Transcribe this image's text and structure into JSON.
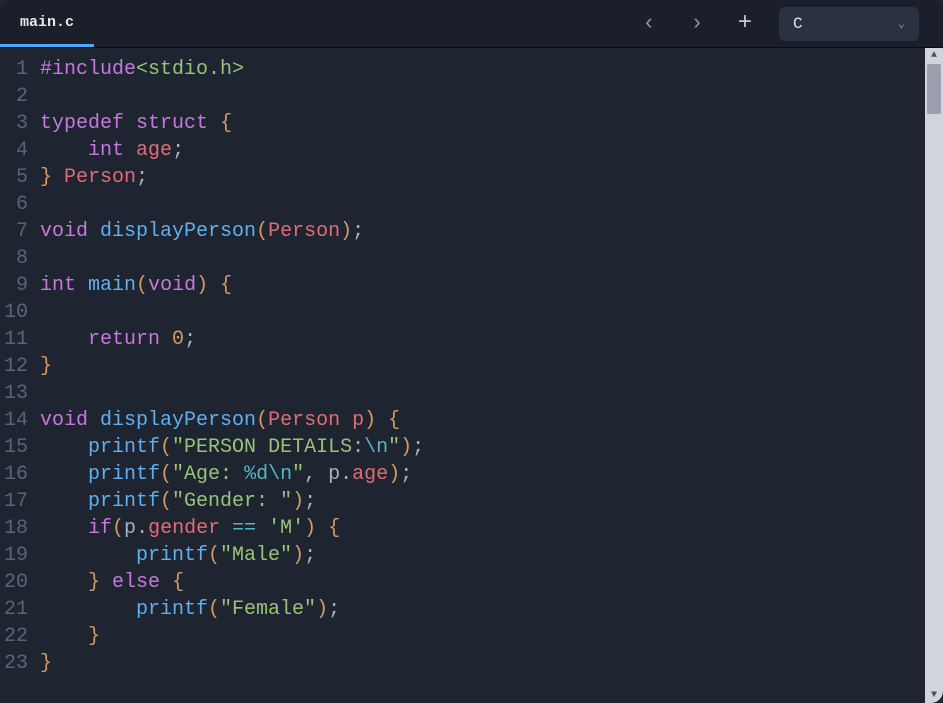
{
  "tab": {
    "filename": "main.c"
  },
  "header": {
    "nav_back": "‹",
    "nav_forward": "›",
    "add": "+",
    "language": "C",
    "chevron": "⌄"
  },
  "code": {
    "lines": [
      {
        "n": "1",
        "tokens": [
          {
            "c": "t-preprocessor",
            "t": "#include"
          },
          {
            "c": "t-include-lit",
            "t": "<stdio.h>"
          }
        ]
      },
      {
        "n": "2",
        "tokens": []
      },
      {
        "n": "3",
        "tokens": [
          {
            "c": "t-keyword",
            "t": "typedef"
          },
          {
            "c": "t-default",
            "t": " "
          },
          {
            "c": "t-keyword",
            "t": "struct"
          },
          {
            "c": "t-default",
            "t": " "
          },
          {
            "c": "t-brace",
            "t": "{"
          }
        ]
      },
      {
        "n": "4",
        "tokens": [
          {
            "c": "t-default",
            "t": "    "
          },
          {
            "c": "t-type",
            "t": "int"
          },
          {
            "c": "t-default",
            "t": " "
          },
          {
            "c": "t-identifier",
            "t": "age"
          },
          {
            "c": "t-punct",
            "t": ";"
          }
        ]
      },
      {
        "n": "5",
        "tokens": [
          {
            "c": "t-brace",
            "t": "}"
          },
          {
            "c": "t-default",
            "t": " "
          },
          {
            "c": "t-identifier",
            "t": "Person"
          },
          {
            "c": "t-punct",
            "t": ";"
          }
        ]
      },
      {
        "n": "6",
        "tokens": []
      },
      {
        "n": "7",
        "tokens": [
          {
            "c": "t-type",
            "t": "void"
          },
          {
            "c": "t-default",
            "t": " "
          },
          {
            "c": "t-function",
            "t": "displayPerson"
          },
          {
            "c": "t-brace",
            "t": "("
          },
          {
            "c": "t-identifier",
            "t": "Person"
          },
          {
            "c": "t-brace",
            "t": ")"
          },
          {
            "c": "t-punct",
            "t": ";"
          }
        ]
      },
      {
        "n": "8",
        "tokens": []
      },
      {
        "n": "9",
        "tokens": [
          {
            "c": "t-type",
            "t": "int"
          },
          {
            "c": "t-default",
            "t": " "
          },
          {
            "c": "t-function",
            "t": "main"
          },
          {
            "c": "t-brace",
            "t": "("
          },
          {
            "c": "t-type",
            "t": "void"
          },
          {
            "c": "t-brace",
            "t": ")"
          },
          {
            "c": "t-default",
            "t": " "
          },
          {
            "c": "t-brace",
            "t": "{"
          }
        ]
      },
      {
        "n": "10",
        "tokens": []
      },
      {
        "n": "11",
        "tokens": [
          {
            "c": "t-default",
            "t": "    "
          },
          {
            "c": "t-keyword",
            "t": "return"
          },
          {
            "c": "t-default",
            "t": " "
          },
          {
            "c": "t-number",
            "t": "0"
          },
          {
            "c": "t-punct",
            "t": ";"
          }
        ]
      },
      {
        "n": "12",
        "tokens": [
          {
            "c": "t-brace",
            "t": "}"
          }
        ]
      },
      {
        "n": "13",
        "tokens": []
      },
      {
        "n": "14",
        "tokens": [
          {
            "c": "t-type",
            "t": "void"
          },
          {
            "c": "t-default",
            "t": " "
          },
          {
            "c": "t-function",
            "t": "displayPerson"
          },
          {
            "c": "t-brace",
            "t": "("
          },
          {
            "c": "t-identifier",
            "t": "Person"
          },
          {
            "c": "t-default",
            "t": " "
          },
          {
            "c": "t-param",
            "t": "p"
          },
          {
            "c": "t-brace",
            "t": ")"
          },
          {
            "c": "t-default",
            "t": " "
          },
          {
            "c": "t-brace",
            "t": "{"
          }
        ]
      },
      {
        "n": "15",
        "tokens": [
          {
            "c": "t-default",
            "t": "    "
          },
          {
            "c": "t-function",
            "t": "printf"
          },
          {
            "c": "t-brace",
            "t": "("
          },
          {
            "c": "t-string",
            "t": "\"PERSON DETAILS:"
          },
          {
            "c": "t-escape",
            "t": "\\n"
          },
          {
            "c": "t-string",
            "t": "\""
          },
          {
            "c": "t-brace",
            "t": ")"
          },
          {
            "c": "t-punct",
            "t": ";"
          }
        ]
      },
      {
        "n": "16",
        "tokens": [
          {
            "c": "t-default",
            "t": "    "
          },
          {
            "c": "t-function",
            "t": "printf"
          },
          {
            "c": "t-brace",
            "t": "("
          },
          {
            "c": "t-string",
            "t": "\"Age: "
          },
          {
            "c": "t-escape",
            "t": "%d"
          },
          {
            "c": "t-escape",
            "t": "\\n"
          },
          {
            "c": "t-string",
            "t": "\""
          },
          {
            "c": "t-punct",
            "t": ","
          },
          {
            "c": "t-default",
            "t": " "
          },
          {
            "c": "t-default",
            "t": "p"
          },
          {
            "c": "t-punct",
            "t": "."
          },
          {
            "c": "t-member",
            "t": "age"
          },
          {
            "c": "t-brace",
            "t": ")"
          },
          {
            "c": "t-punct",
            "t": ";"
          }
        ]
      },
      {
        "n": "17",
        "tokens": [
          {
            "c": "t-default",
            "t": "    "
          },
          {
            "c": "t-function",
            "t": "printf"
          },
          {
            "c": "t-brace",
            "t": "("
          },
          {
            "c": "t-string",
            "t": "\"Gender: \""
          },
          {
            "c": "t-brace",
            "t": ")"
          },
          {
            "c": "t-punct",
            "t": ";"
          }
        ]
      },
      {
        "n": "18",
        "tokens": [
          {
            "c": "t-default",
            "t": "    "
          },
          {
            "c": "t-keyword",
            "t": "if"
          },
          {
            "c": "t-brace",
            "t": "("
          },
          {
            "c": "t-default",
            "t": "p"
          },
          {
            "c": "t-punct",
            "t": "."
          },
          {
            "c": "t-member",
            "t": "gender"
          },
          {
            "c": "t-default",
            "t": " "
          },
          {
            "c": "t-operator",
            "t": "=="
          },
          {
            "c": "t-default",
            "t": " "
          },
          {
            "c": "t-char",
            "t": "'M'"
          },
          {
            "c": "t-brace",
            "t": ")"
          },
          {
            "c": "t-default",
            "t": " "
          },
          {
            "c": "t-brace",
            "t": "{"
          }
        ]
      },
      {
        "n": "19",
        "tokens": [
          {
            "c": "t-default",
            "t": "        "
          },
          {
            "c": "t-function",
            "t": "printf"
          },
          {
            "c": "t-brace",
            "t": "("
          },
          {
            "c": "t-string",
            "t": "\"Male\""
          },
          {
            "c": "t-brace",
            "t": ")"
          },
          {
            "c": "t-punct",
            "t": ";"
          }
        ]
      },
      {
        "n": "20",
        "tokens": [
          {
            "c": "t-default",
            "t": "    "
          },
          {
            "c": "t-brace",
            "t": "}"
          },
          {
            "c": "t-default",
            "t": " "
          },
          {
            "c": "t-keyword",
            "t": "else"
          },
          {
            "c": "t-default",
            "t": " "
          },
          {
            "c": "t-brace",
            "t": "{"
          }
        ]
      },
      {
        "n": "21",
        "tokens": [
          {
            "c": "t-default",
            "t": "        "
          },
          {
            "c": "t-function",
            "t": "printf"
          },
          {
            "c": "t-brace",
            "t": "("
          },
          {
            "c": "t-string",
            "t": "\"Female\""
          },
          {
            "c": "t-brace",
            "t": ")"
          },
          {
            "c": "t-punct",
            "t": ";"
          }
        ]
      },
      {
        "n": "22",
        "tokens": [
          {
            "c": "t-default",
            "t": "    "
          },
          {
            "c": "t-brace",
            "t": "}"
          }
        ]
      },
      {
        "n": "23",
        "tokens": [
          {
            "c": "t-brace",
            "t": "}"
          }
        ]
      }
    ]
  },
  "scrollbar": {
    "up": "▲",
    "down": "▼"
  }
}
